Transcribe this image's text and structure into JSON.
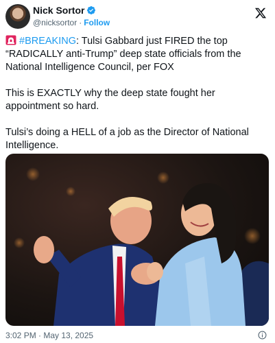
{
  "author": {
    "display_name": "Nick Sortor",
    "handle": "@nicksortor",
    "separator": "·",
    "follow_label": "Follow",
    "verified_icon": "verified-badge-icon",
    "avatar_icon": "profile-avatar"
  },
  "platform_icon": "x-logo-icon",
  "tweet": {
    "siren_icon": "rotating-light-emoji",
    "hashtag": "#BREAKING",
    "paragraph_1_rest": ": Tulsi Gabbard just FIRED the top “RADICALLY anti-Trump” deep state officials from the National Intelligence Council, per FOX",
    "paragraph_2": "This is EXACTLY why the deep state fought her appointment so hard.",
    "paragraph_3": "Tulsi’s doing a HELL of a job as the Director of National Intelligence."
  },
  "media": {
    "type": "photo"
  },
  "footer": {
    "timestamp": "3:02 PM · May 13, 2025",
    "info_icon": "info-icon"
  },
  "colors": {
    "accent": "#1d9bf0",
    "text": "#0f1419",
    "secondary": "#536471"
  }
}
